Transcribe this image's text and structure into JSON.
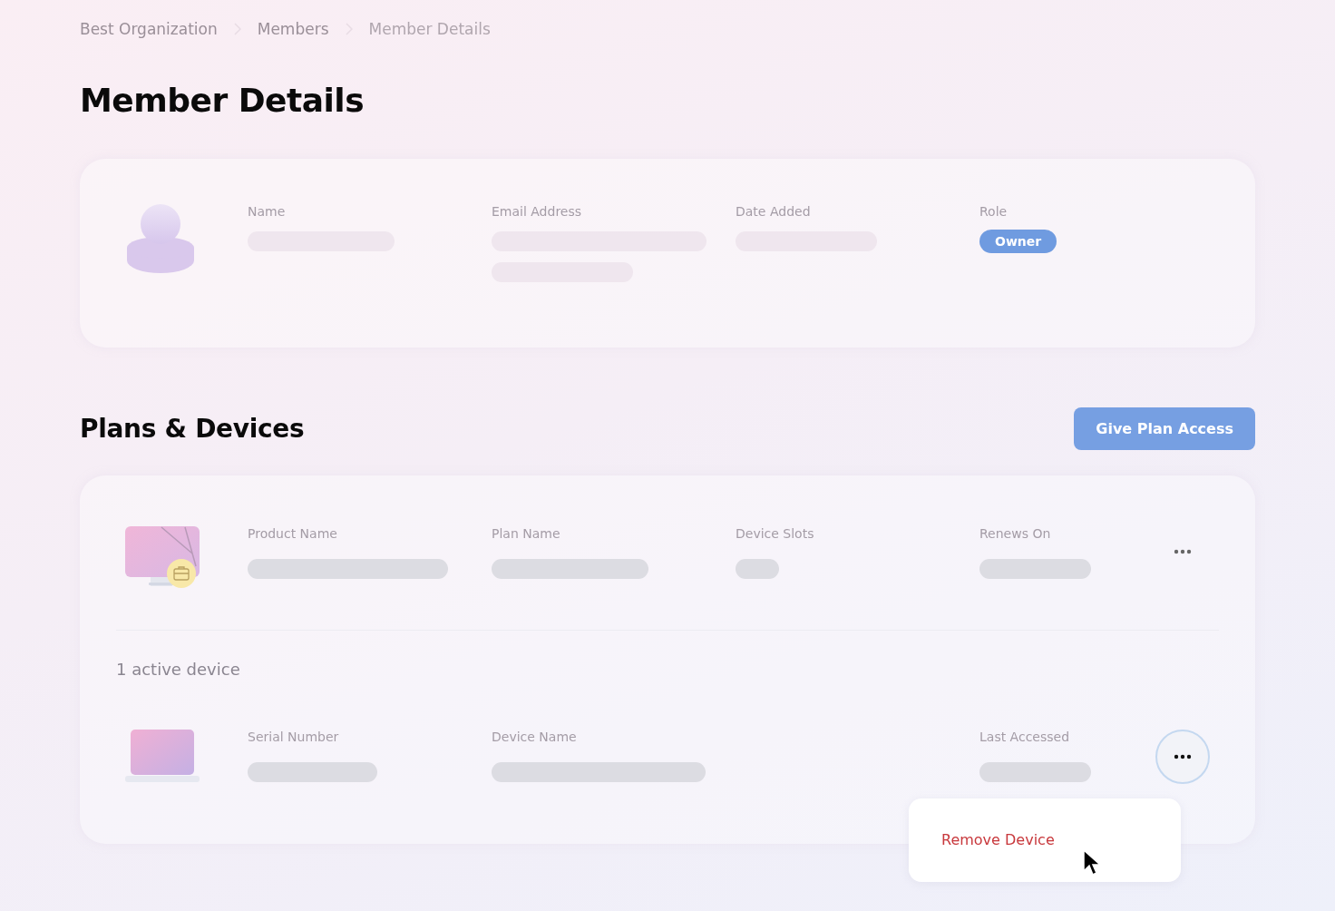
{
  "breadcrumb": [
    {
      "label": "Best Organization",
      "current": false
    },
    {
      "label": "Members",
      "current": false
    },
    {
      "label": "Member Details",
      "current": true
    }
  ],
  "title": "Member Details",
  "member": {
    "fields": [
      {
        "label": "Name"
      },
      {
        "label": "Email Address"
      },
      {
        "label": "Date Added"
      },
      {
        "label": "Role",
        "badge": "Owner"
      }
    ]
  },
  "plans_section": {
    "title": "Plans & Devices",
    "button": {
      "label": "Give Plan Access",
      "disabled": true
    }
  },
  "plan": {
    "fields": [
      {
        "label": "Product Name"
      },
      {
        "label": "Plan Name"
      },
      {
        "label": "Device Slots"
      },
      {
        "label": "Renews On"
      }
    ],
    "menu_open": false
  },
  "devices_count": "1 active device",
  "device": {
    "fields": [
      {
        "label": "Serial Number"
      },
      {
        "label": "Device Name"
      },
      {
        "label": "Last Accessed"
      }
    ],
    "menu_open": true,
    "menu_items": [
      {
        "label": "Remove Device",
        "kind": "danger"
      }
    ]
  }
}
